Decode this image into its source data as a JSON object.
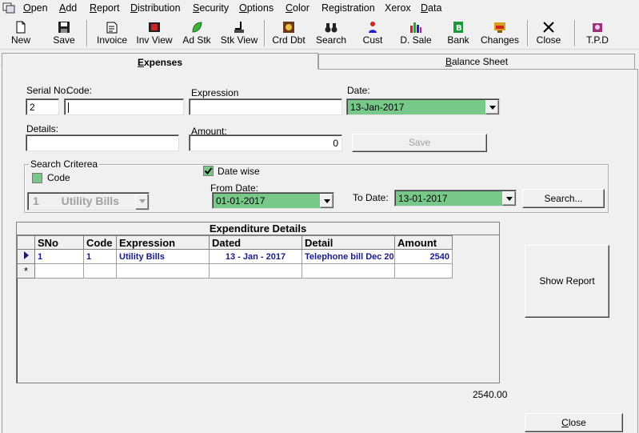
{
  "menubar": {
    "items": [
      {
        "label": "Open",
        "ul": "O",
        "rest": "pen"
      },
      {
        "label": "Add",
        "ul": "A",
        "rest": "dd"
      },
      {
        "label": "Report",
        "ul": "R",
        "rest": "eport"
      },
      {
        "label": "Distribution",
        "ul": "D",
        "rest": "istribution"
      },
      {
        "label": "Security",
        "ul": "S",
        "rest": "ecurity"
      },
      {
        "label": "Options",
        "ul": "O",
        "rest": "ptions"
      },
      {
        "label": "Color",
        "ul": "C",
        "rest": "olor"
      },
      {
        "label": "Registration",
        "ul": "",
        "rest": "Registration"
      },
      {
        "label": "Xerox",
        "ul": "",
        "rest": "Xerox"
      },
      {
        "label": "Data",
        "ul": "D",
        "rest": "ata"
      }
    ]
  },
  "toolbar": {
    "new": "New",
    "save": "Save",
    "invoice": "Invoice",
    "inv_view": "Inv View",
    "ad_stk": "Ad Stk",
    "stk_view": "Stk View",
    "crd_dbt": "Crd Dbt",
    "search": "Search",
    "cust": "Cust",
    "d_sale": "D. Sale",
    "bank": "Bank",
    "changes": "Changes",
    "close": "Close",
    "tpd": "T.P.D"
  },
  "tabs": {
    "expenses": {
      "ul": "E",
      "rest": "xpenses"
    },
    "balance_sheet": {
      "ul": "B",
      "rest": "alance Sheet"
    }
  },
  "form": {
    "serial_no_label": "Serial No:",
    "serial_no_value": "2",
    "code_label": "Code:",
    "code_value": "",
    "expression_label": "Expression",
    "expression_value": "",
    "date_label": "Date:",
    "date_value": "13-Jan-2017",
    "details_label": "Details:",
    "details_value": "",
    "amount_label": "Amount:",
    "amount_value": "0",
    "save_button": "Save"
  },
  "search": {
    "group_title": "Search Criterea",
    "code_checkbox_label": "Code",
    "code_checked": false,
    "datewise_label": "Date wise",
    "datewise_checked": true,
    "category_code": "1",
    "category_name": "Utility Bills",
    "from_date_label": "From Date:",
    "from_date_value": "01-01-2017",
    "to_date_label": "To Date:",
    "to_date_value": "13-01-2017",
    "search_button": "Search..."
  },
  "grid": {
    "caption": "Expenditure Details",
    "columns": [
      "SNo",
      "Code",
      "Expression",
      "Dated",
      "Detail",
      "Amount"
    ],
    "rows": [
      {
        "sno": "1",
        "code": "1",
        "expression": "Utility Bills",
        "dated": "13 - Jan - 2017",
        "detail": "Telephone bill Dec 20",
        "amount": "2540"
      }
    ],
    "new_row_marker": "*"
  },
  "total": "2540.00",
  "buttons": {
    "show_report": "Show Report",
    "close": "Close"
  },
  "colors": {
    "date_field_bg": "#78c88a",
    "grid_text": "#1a1a8a"
  }
}
